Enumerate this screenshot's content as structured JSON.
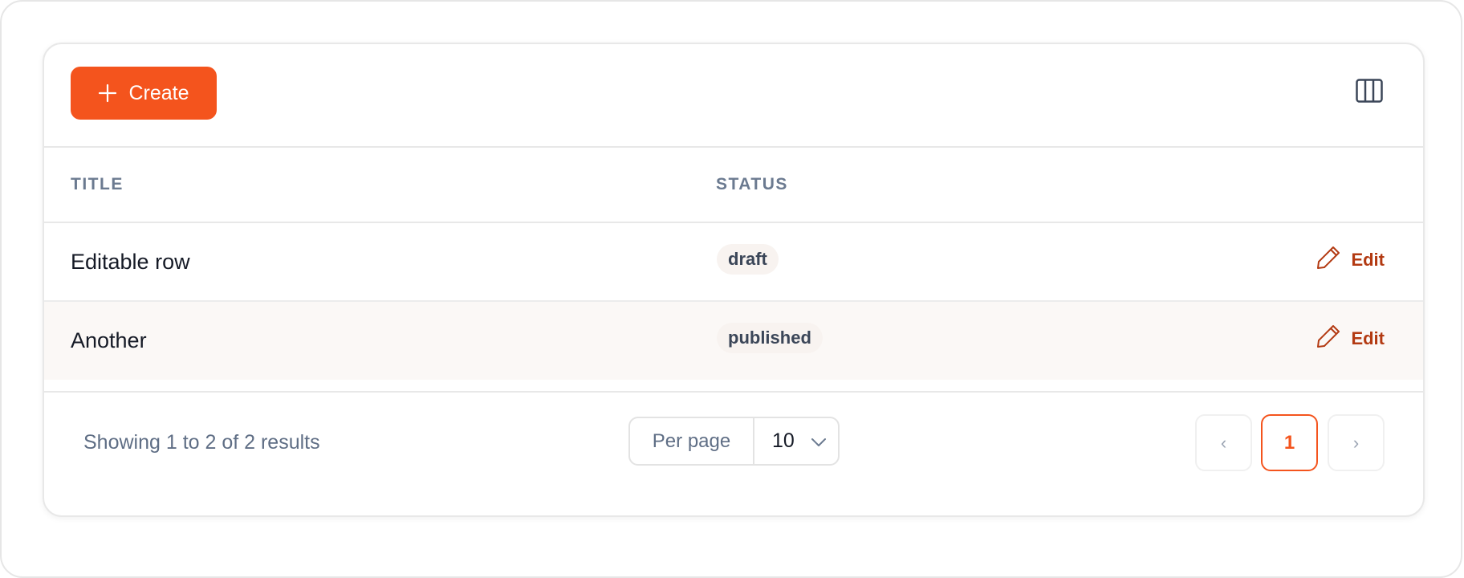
{
  "toolbar": {
    "create_label": "Create",
    "create_icon": "plus-icon",
    "columns_icon": "columns-icon"
  },
  "table": {
    "columns": [
      "TITLE",
      "STATUS"
    ],
    "rows": [
      {
        "title": "Editable row",
        "status": "draft",
        "action": "Edit"
      },
      {
        "title": "Another",
        "status": "published",
        "action": "Edit"
      }
    ]
  },
  "footer": {
    "results_text": "Showing 1 to 2 of 2 results",
    "per_page_label": "Per page",
    "per_page_value": "10",
    "pagination": {
      "prev": "‹",
      "current": "1",
      "next": "›"
    }
  },
  "colors": {
    "accent": "#f4541d",
    "edit": "#b33a12",
    "muted_text": "#6b7a90"
  }
}
